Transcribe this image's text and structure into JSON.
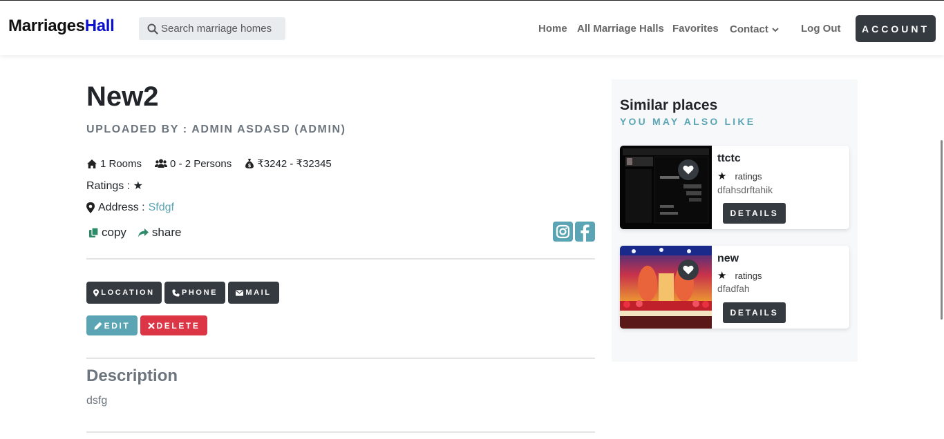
{
  "nav": {
    "brand_main": "Marriages",
    "brand_accent": "Hall",
    "search_placeholder": "Search marriage homes",
    "links": {
      "home": "Home",
      "all_halls": "All Marriage Halls",
      "favorites": "Favorites",
      "contact": "Contact",
      "logout": "Log Out"
    },
    "account": "ACCOUNT"
  },
  "hall": {
    "title": "New2",
    "uploaded_by": "UPLOADED BY : ADMIN ASDASD (ADMIN)",
    "rooms": "1 Rooms",
    "persons": "0 - 2 Persons",
    "price": "₹3242 - ₹32345",
    "ratings_label": "Ratings : ★",
    "address_label": "Address :",
    "address_value": "Sfdgf",
    "copy": "copy",
    "share": "share"
  },
  "buttons": {
    "location": "LOCATION",
    "phone": "PHONE",
    "mail": "MAIL",
    "edit": "EDIT",
    "delete": "DELETE"
  },
  "description": {
    "title": "Description",
    "text": "dsfg"
  },
  "sidebar": {
    "title": "Similar places",
    "subtitle": "YOU MAY ALSO LIKE",
    "cards": [
      {
        "name": "ttctc",
        "star": "★",
        "ratings": "ratings",
        "sub": "dfahsdrftahik",
        "button": "DETAILS"
      },
      {
        "name": "new",
        "star": "★",
        "ratings": "ratings",
        "sub": "dfadfah",
        "button": "DETAILS"
      }
    ]
  },
  "icons": [
    "search-icon",
    "chevron-down-icon",
    "home-icon",
    "users-icon",
    "money-bag-icon",
    "map-marker-icon",
    "copy-icon",
    "share-icon",
    "instagram-icon",
    "facebook-icon",
    "phone-icon",
    "mail-icon",
    "pencil-icon",
    "close-icon",
    "heart-icon"
  ],
  "colors": {
    "accent": "#5aa4b4",
    "dark": "#343a40",
    "danger": "#dc3545",
    "brand_blue": "#0a10cc"
  }
}
